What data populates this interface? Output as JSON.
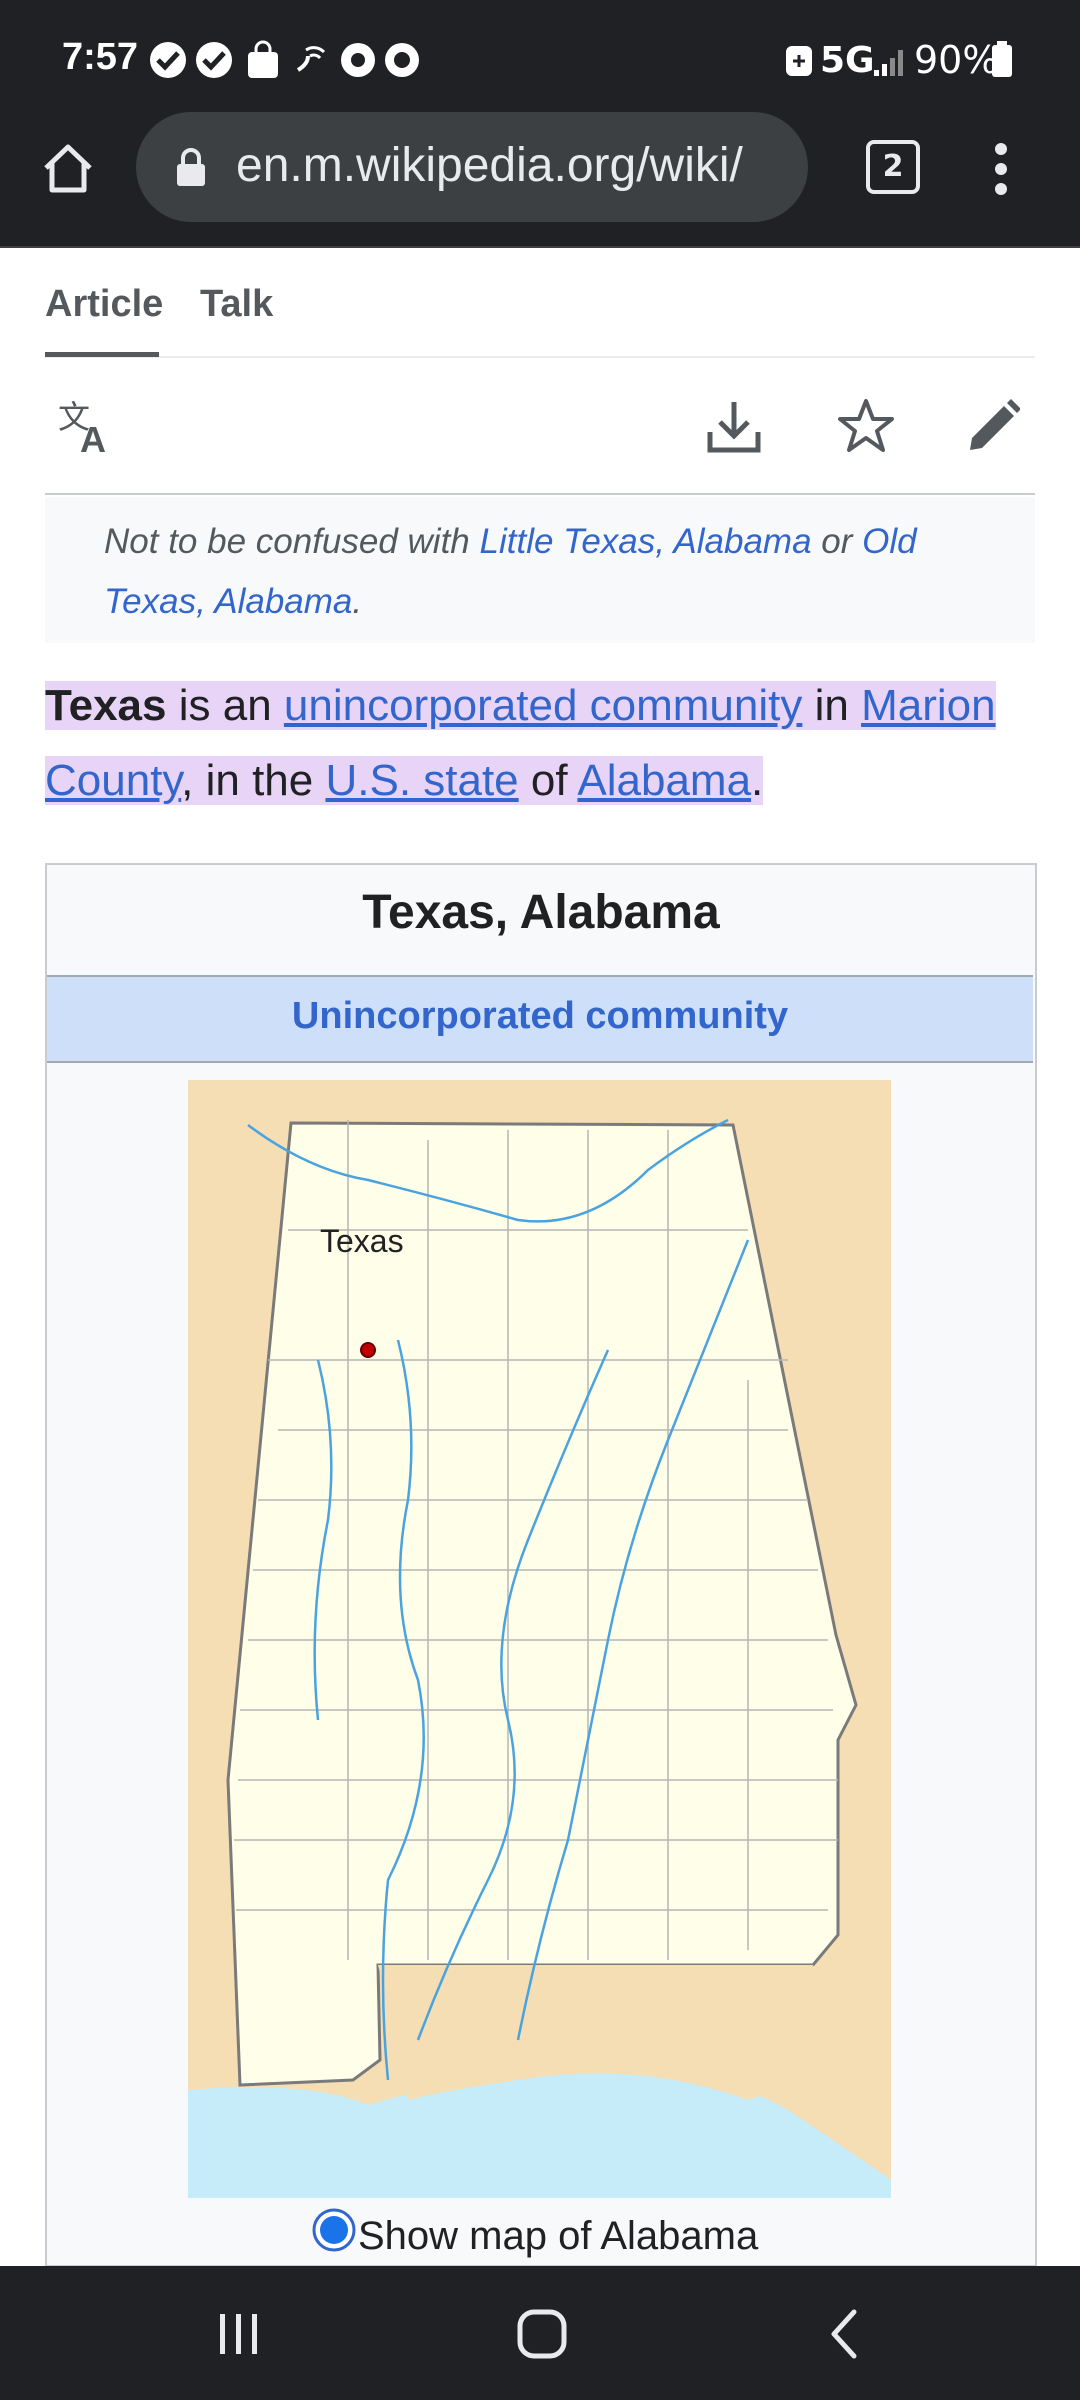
{
  "status_bar": {
    "time": "7:57",
    "network": "5G",
    "battery": "90%",
    "icons": [
      "check-badge-icon",
      "check-badge-icon",
      "shopping-bag-icon",
      "wifi-call-icon",
      "chrome-icon",
      "refresh-circle-icon",
      "dot-icon",
      "battery-saver-icon",
      "signal-icon",
      "battery-icon"
    ]
  },
  "browser": {
    "url": "en.m.wikipedia.org/wiki/",
    "tab_count": "2"
  },
  "page_tabs": {
    "article": "Article",
    "talk": "Talk"
  },
  "hatnote": {
    "prefix": "Not to be confused with ",
    "link1": "Little Texas, Alabama",
    "middle": " or ",
    "link2a": "Old",
    "link2b": "Texas, Alabama",
    "suffix": "."
  },
  "lead": {
    "subject": "Texas",
    "t1": " is an ",
    "link1": "unincorporated community",
    "t2": " in ",
    "link2a": "Marion",
    "link2b": "County",
    "t3": ", in the ",
    "link3": "U.S. state",
    "t4": " of ",
    "link4": "Alabama",
    "t5": "."
  },
  "infobox": {
    "title": "Texas, Alabama",
    "subtitle": "Unincorporated community",
    "map_marker_label": "Texas",
    "map_toggle_label": "Show map of Alabama"
  },
  "colors": {
    "chrome_bg": "#202124",
    "link": "#3366cc",
    "highlight": "#e8d4f7",
    "infobox_header": "#cedff9",
    "map_land": "#fefee9",
    "map_surround": "#f5deb3",
    "map_water": "#c6ecfa"
  }
}
